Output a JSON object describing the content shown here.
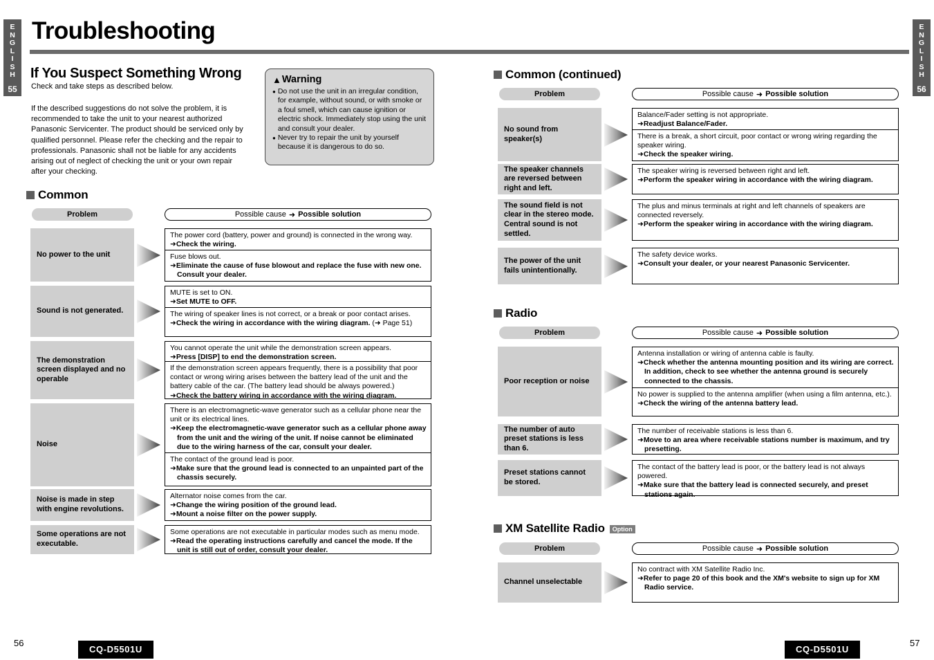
{
  "lang_tabs": {
    "letters": [
      "E",
      "N",
      "G",
      "L",
      "I",
      "S",
      "H"
    ],
    "left_page": "55",
    "right_page": "56"
  },
  "title": "Troubleshooting",
  "intro": {
    "heading": "If You Suspect Something Wrong",
    "subtitle": "Check and take steps as described below.",
    "body": "If the described suggestions do not solve the problem, it is recommended to take the unit to your nearest authorized Panasonic Servicenter. The product should be serviced only by qualified personnel. Please refer the checking and the repair to professionals. Panasonic shall not be liable for any accidents arising out of neglect of checking the unit or your own repair after your checking."
  },
  "warning": {
    "title": "Warning",
    "icon": "warning-triangle-icon",
    "items": [
      "Do not use the unit in an irregular condition, for example, without sound, or with smoke or a foul smell, which can cause ignition or electric shock. Immediately stop using the unit and consult your dealer.",
      "Never try to repair the unit by yourself because it is dangerous to do so."
    ]
  },
  "table_headers": {
    "problem": "Problem",
    "cause_label": "Possible cause",
    "arrow": "➜",
    "solution_label": "Possible solution"
  },
  "sections": {
    "common": {
      "heading": "Common",
      "rows": [
        {
          "problem": "No power to the unit",
          "cells": [
            {
              "cause": "The power cord (battery, power and ground) is connected in the wrong way.",
              "fix": "Check the wiring."
            },
            {
              "cause": "Fuse blows out.",
              "fix": "Eliminate the cause of fuse blowout and replace the fuse with new one. Consult your dealer."
            }
          ]
        },
        {
          "problem": "Sound is not generated.",
          "cells": [
            {
              "cause": "MUTE is set to ON.",
              "fix": "Set MUTE to OFF."
            },
            {
              "cause": "The wiring of speaker lines is not correct, or a break or poor contact arises.",
              "fix": "Check the wiring in accordance with the wiring diagram.",
              "fix_suffix": "(➜ Page 51)"
            }
          ]
        },
        {
          "problem": "The demonstration screen displayed and no operable",
          "cells": [
            {
              "cause": "You cannot operate the unit while the demonstration screen appears.",
              "fix": "Press [DISP] to end the demonstration screen."
            },
            {
              "cause": "If the demonstration screen appears frequently, there is a possibility that poor contact or wrong wiring arises between the battery lead of the unit and the battery cable of the car. (The battery lead should be always powered.)",
              "fix": "Check the battery wiring in accordance with the wiring diagram."
            }
          ]
        },
        {
          "problem": "Noise",
          "cells": [
            {
              "cause": "There is an electromagnetic-wave generator such as a cellular phone near the unit or its electrical lines.",
              "fix": "Keep the electromagnetic-wave generator such as a cellular phone away from the unit and the wiring of the unit. If noise cannot be eliminated due to the wiring harness of the car, consult your dealer."
            },
            {
              "cause": "The contact of the ground lead is poor.",
              "fix": "Make sure that the ground lead is connected to an unpainted part of the chassis securely."
            }
          ]
        },
        {
          "problem": "Noise is made in step with engine revolutions.",
          "cells": [
            {
              "cause": "Alternator noise comes from the car.",
              "fix": "Change the wiring position of the ground lead.",
              "fix2": "Mount a noise filter on the power supply."
            }
          ]
        },
        {
          "problem": "Some operations are not executable.",
          "cells": [
            {
              "cause": "Some operations are not executable in particular modes such as menu mode.",
              "fix": "Read the operating instructions carefully and cancel the mode. If the unit is still out of order, consult your dealer."
            }
          ]
        }
      ]
    },
    "common_continued": {
      "heading": "Common (continued)",
      "rows": [
        {
          "problem": "No sound from speaker(s)",
          "cells": [
            {
              "cause": "Balance/Fader setting is not appropriate.",
              "fix": "Readjust Balance/Fader."
            },
            {
              "cause": "There is a break, a short circuit, poor contact or wrong wiring regarding the speaker wiring.",
              "fix": "Check the speaker wiring."
            }
          ]
        },
        {
          "problem": "The speaker channels are reversed between right and left.",
          "cells": [
            {
              "cause": "The speaker wiring is reversed between right and left.",
              "fix": "Perform the speaker wiring in accordance with the wiring diagram."
            }
          ]
        },
        {
          "problem": "The sound field is not clear in the stereo mode. Central sound is not settled.",
          "cells": [
            {
              "cause": "The plus and minus terminals at right and left channels of speakers are connected reversely.",
              "fix": "Perform the speaker wiring in accordance with the wiring diagram."
            }
          ]
        },
        {
          "problem": "The power of the unit fails unintentionally.",
          "cells": [
            {
              "cause": "The safety device works.",
              "fix": "Consult your dealer, or your nearest Panasonic Servicenter."
            }
          ]
        }
      ]
    },
    "radio": {
      "heading": "Radio",
      "rows": [
        {
          "problem": "Poor reception or noise",
          "cells": [
            {
              "cause": "Antenna installation or wiring of antenna cable is faulty.",
              "fix": "Check whether the antenna mounting position and its wiring are correct. In addition, check to see whether the antenna ground is securely connected to the chassis."
            },
            {
              "cause": "No power is supplied to the antenna amplifier (when using a film antenna, etc.).",
              "fix": "Check the wiring of the antenna battery lead."
            }
          ]
        },
        {
          "problem": "The number of auto preset stations is less than 6.",
          "cells": [
            {
              "cause": "The number of receivable stations is less than 6.",
              "fix": "Move to an area where receivable stations number is maximum, and try presetting."
            }
          ]
        },
        {
          "problem": "Preset stations cannot be stored.",
          "cells": [
            {
              "cause": "The contact of the battery lead is poor, or the battery lead is not always powered.",
              "fix": "Make sure that the battery lead is connected securely, and preset stations again."
            }
          ]
        }
      ]
    },
    "xm": {
      "heading": "XM Satellite Radio",
      "option_badge": "Option",
      "rows": [
        {
          "problem": "Channel unselectable",
          "cells": [
            {
              "cause": "No contract with XM Satellite Radio Inc.",
              "fix": "Refer to page 20 of this book and the XM's website to sign up for XM Radio service."
            }
          ]
        }
      ]
    }
  },
  "footer": {
    "left_page": "56",
    "right_page": "57",
    "model": "CQ-D5501U"
  }
}
